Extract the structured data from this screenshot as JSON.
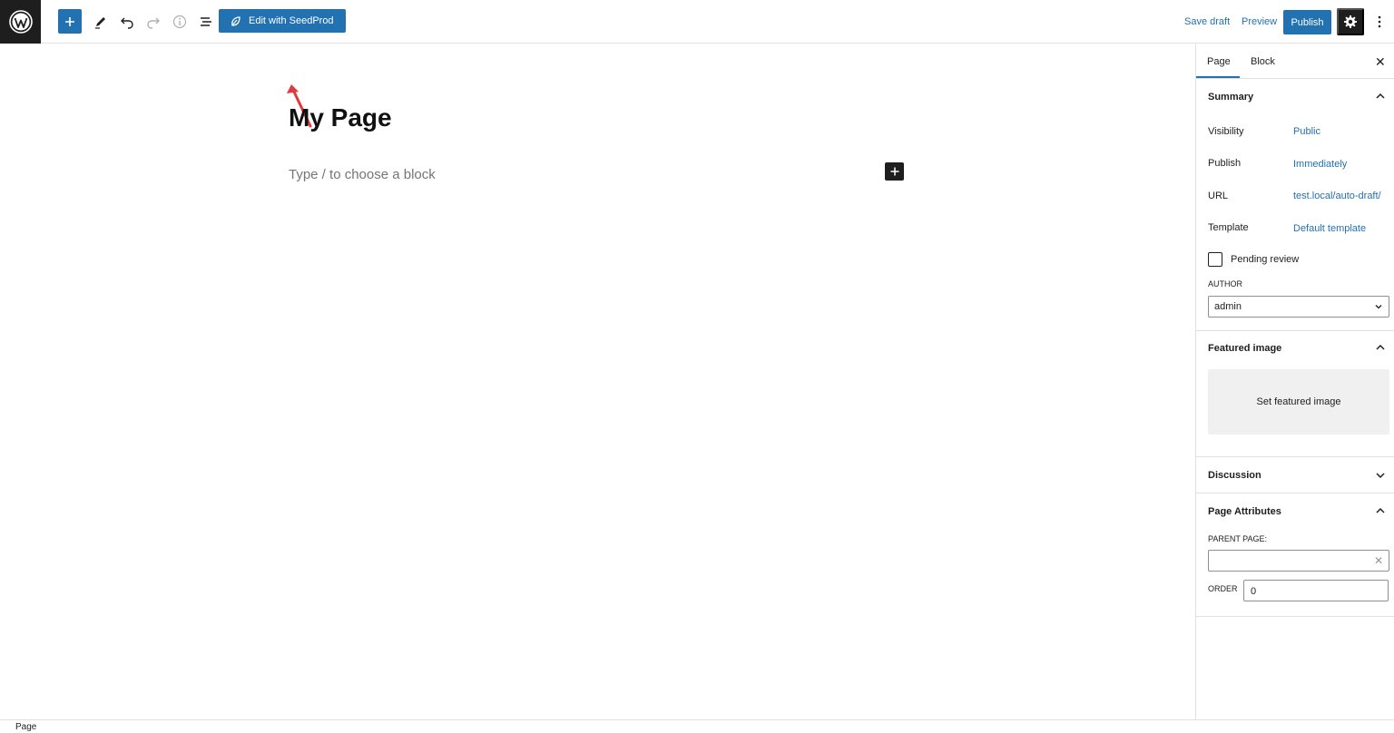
{
  "toolbar": {
    "seedprod_label": "Edit with SeedProd",
    "save_draft": "Save draft",
    "preview": "Preview",
    "publish": "Publish"
  },
  "editor": {
    "title": "My Page",
    "placeholder": "Type / to choose a block"
  },
  "sidebar": {
    "tabs": [
      "Page",
      "Block"
    ],
    "active_tab": "Page",
    "summary": {
      "heading": "Summary",
      "rows": [
        {
          "label": "Visibility",
          "value": "Public"
        },
        {
          "label": "Publish",
          "value": "Immediately"
        },
        {
          "label": "URL",
          "value": "test.local/auto-draft/"
        },
        {
          "label": "Template",
          "value": "Default template"
        }
      ],
      "pending_review": "Pending review",
      "author_label": "AUTHOR",
      "author_value": "admin"
    },
    "featured": {
      "heading": "Featured image",
      "button": "Set featured image"
    },
    "discussion": {
      "heading": "Discussion"
    },
    "attributes": {
      "heading": "Page Attributes",
      "parent_label": "PARENT PAGE:",
      "order_label": "ORDER",
      "order_value": "0"
    }
  },
  "footer": {
    "breadcrumb": "Page"
  },
  "colors": {
    "accent": "#2271b1",
    "dark": "#1e1e1e",
    "annotation_arrow": "#e0393e"
  }
}
